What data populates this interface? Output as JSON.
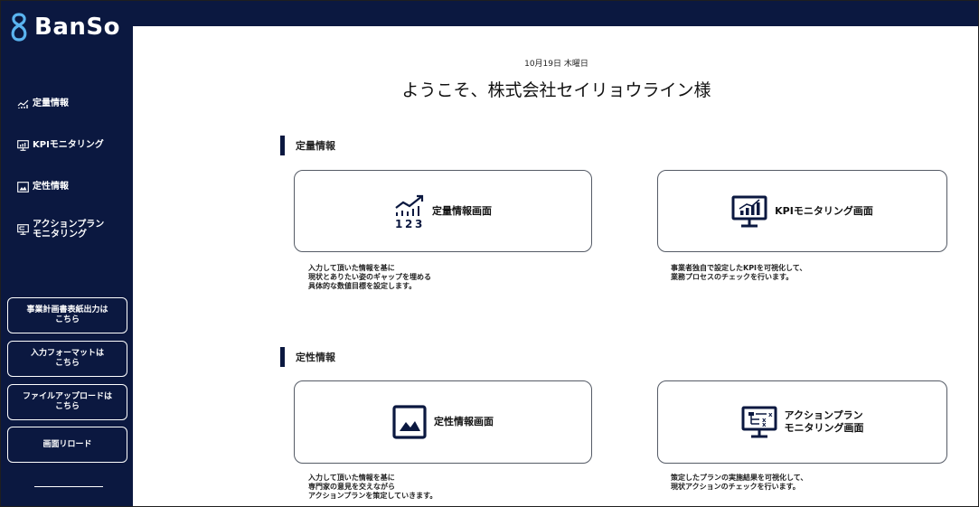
{
  "app": {
    "logo_text": "BanSo"
  },
  "sidebar": {
    "nav": [
      {
        "label": "定量情報",
        "icon": "chart-trend-icon"
      },
      {
        "label": "KPIモニタリング",
        "icon": "monitor-chart-icon"
      },
      {
        "label": "定性情報",
        "icon": "image-icon"
      },
      {
        "label": "アクションプラン\nモニタリング",
        "icon": "flow-monitor-icon"
      }
    ],
    "buttons": [
      {
        "label": "事業計画書表紙出力は\nこちら"
      },
      {
        "label": "入力フォーマットは\nこちら"
      },
      {
        "label": "ファイルアップロードは\nこちら"
      },
      {
        "label": "画面リロード"
      }
    ]
  },
  "main": {
    "date": "10月19日 木曜日",
    "welcome": "ようこそ、株式会社セイリョウライン様",
    "sections": [
      {
        "title": "定量情報",
        "cards": [
          {
            "title": "定量情報画面",
            "icon": "chart-123-icon",
            "desc": "入力して頂いた情報を基に\n現状とありたい姿のギャップを埋める\n具体的な数値目標を設定します。"
          },
          {
            "title": "KPIモニタリング画面",
            "icon": "monitor-chart-icon",
            "desc": "事業者独自で設定したKPIを可視化して、\n業務プロセスのチェックを行います。"
          }
        ]
      },
      {
        "title": "定性情報",
        "cards": [
          {
            "title": "定性情報画面",
            "icon": "image-icon",
            "desc": "入力して頂いた情報を基に\n専門家の意見を交えながら\nアクションプランを策定していきます。"
          },
          {
            "title": "アクションプラン\nモニタリング画面",
            "icon": "flow-monitor-icon",
            "desc": "策定したプランの実施結果を可視化して、\n現状アクションのチェックを行います。"
          }
        ]
      }
    ]
  },
  "colors": {
    "navy": "#0b1840",
    "border": "#555b66"
  }
}
